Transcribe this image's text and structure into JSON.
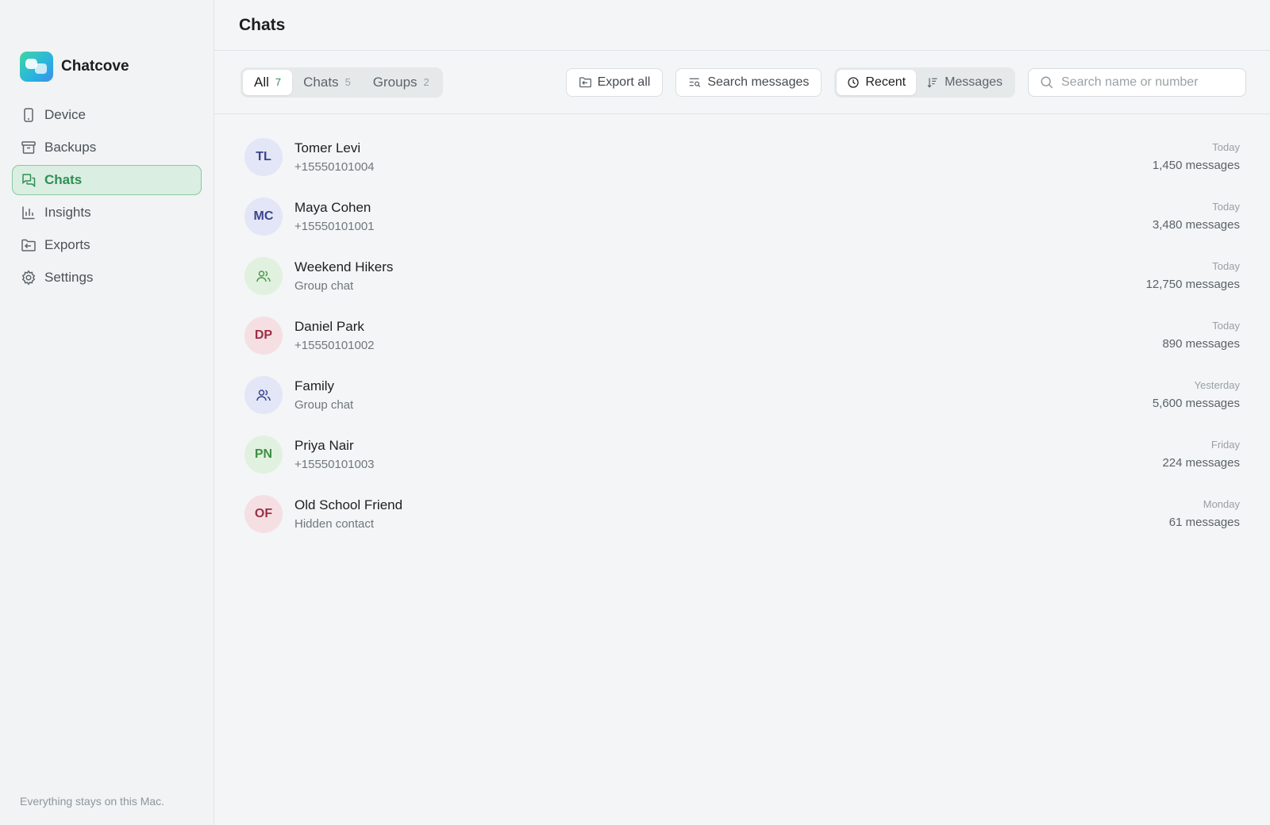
{
  "app": {
    "name": "Chatcove",
    "footer": "Everything stays on this Mac."
  },
  "sidebar": {
    "items": [
      {
        "label": "Device",
        "icon": "phone-icon",
        "active": false
      },
      {
        "label": "Backups",
        "icon": "archive-icon",
        "active": false
      },
      {
        "label": "Chats",
        "icon": "chat-bubbles-icon",
        "active": true
      },
      {
        "label": "Insights",
        "icon": "bar-chart-icon",
        "active": false
      },
      {
        "label": "Exports",
        "icon": "folder-export-icon",
        "active": false
      },
      {
        "label": "Settings",
        "icon": "gear-icon",
        "active": false
      }
    ]
  },
  "header": {
    "title": "Chats"
  },
  "toolbar": {
    "filters": [
      {
        "label": "All",
        "count": "7",
        "active": true
      },
      {
        "label": "Chats",
        "count": "5",
        "active": false
      },
      {
        "label": "Groups",
        "count": "2",
        "active": false
      }
    ],
    "export_label": "Export all",
    "search_messages_label": "Search messages",
    "sort": [
      {
        "label": "Recent",
        "icon": "clock-icon",
        "active": true
      },
      {
        "label": "Messages",
        "icon": "sort-icon",
        "active": false
      }
    ],
    "search": {
      "placeholder": "Search name or number",
      "value": ""
    }
  },
  "colors": {
    "accent": "#2f8f55",
    "accent_bg": "#dbeee2"
  },
  "chats": [
    {
      "initials": "TL",
      "name": "Tomer Levi",
      "sub": "+15550101004",
      "date": "Today",
      "count": "1,450 messages",
      "group": false,
      "bg": "#e3e6f6",
      "fg": "#3a4590"
    },
    {
      "initials": "MC",
      "name": "Maya Cohen",
      "sub": "+15550101001",
      "date": "Today",
      "count": "3,480 messages",
      "group": false,
      "bg": "#e3e6f6",
      "fg": "#3a4590"
    },
    {
      "initials": "",
      "name": "Weekend Hikers",
      "sub": "Group chat",
      "date": "Today",
      "count": "12,750 messages",
      "group": true,
      "bg": "#e1f1df",
      "fg": "#4a9a4e"
    },
    {
      "initials": "DP",
      "name": "Daniel Park",
      "sub": "+15550101002",
      "date": "Today",
      "count": "890 messages",
      "group": false,
      "bg": "#f6dfe3",
      "fg": "#9a3045"
    },
    {
      "initials": "",
      "name": "Family",
      "sub": "Group chat",
      "date": "Yesterday",
      "count": "5,600 messages",
      "group": true,
      "bg": "#e3e6f6",
      "fg": "#3a4590"
    },
    {
      "initials": "PN",
      "name": "Priya Nair",
      "sub": "+15550101003",
      "date": "Friday",
      "count": "224 messages",
      "group": false,
      "bg": "#e1f1df",
      "fg": "#3f8f45"
    },
    {
      "initials": "OF",
      "name": "Old School Friend",
      "sub": "Hidden contact",
      "date": "Monday",
      "count": "61 messages",
      "group": false,
      "bg": "#f6dfe3",
      "fg": "#9a3045"
    }
  ]
}
